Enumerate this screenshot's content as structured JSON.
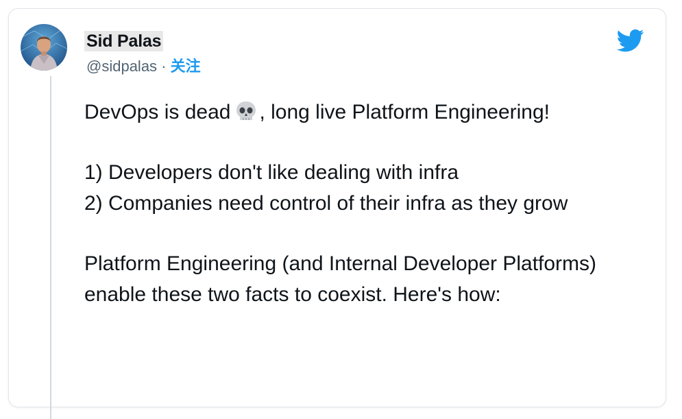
{
  "author": {
    "display_name": "Sid Palas",
    "handle": "@sidpalas",
    "separator": "·",
    "follow_label": "关注"
  },
  "tweet": {
    "line1_before": "DevOps is dead",
    "line1_after": ", long live Platform Engineering!",
    "point1": "1) Developers don't like dealing with infra",
    "point2": "2) Companies need control of their infra as they grow",
    "closing": "Platform Engineering (and Internal Developer Platforms) enable these two facts to coexist. Here's how:"
  },
  "icons": {
    "platform": "twitter-bird-icon",
    "emoji": "skull-icon"
  },
  "colors": {
    "twitter_blue": "#1d9bf0",
    "text": "#0f1419",
    "muted": "#536471",
    "border": "#e1e4e8"
  }
}
